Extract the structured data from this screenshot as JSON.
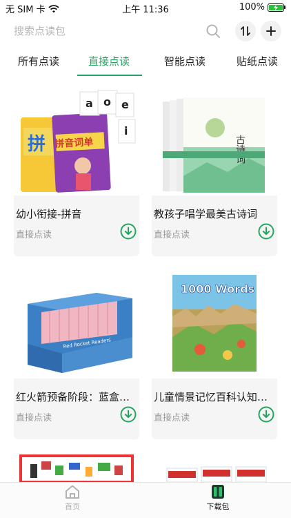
{
  "status": {
    "carrier": "无 SIM 卡",
    "time": "上午 11:36",
    "battery": "100%"
  },
  "search": {
    "placeholder": "搜索点读包"
  },
  "tabs": [
    {
      "label": "所有点读",
      "active": false
    },
    {
      "label": "直接点读",
      "active": true
    },
    {
      "label": "智能点读",
      "active": false
    },
    {
      "label": "贴纸点读",
      "active": false
    }
  ],
  "books": [
    {
      "title": "幼小衔接-拼音",
      "subtitle": "直接点读",
      "cover_text": "拼音词单"
    },
    {
      "title": "教孩子唱学最美古诗词",
      "subtitle": "直接点读",
      "cover_text": "古诗词"
    },
    {
      "title": "红火箭预备阶段：蓝盒…",
      "subtitle": "直接点读",
      "cover_text": "Red Rocket Readers"
    },
    {
      "title": "儿童情景记忆百科认知…",
      "subtitle": "直接点读",
      "cover_text": "1000 Words"
    }
  ],
  "bottom_nav": [
    {
      "label": "首页",
      "active": false
    },
    {
      "label": "下载包",
      "active": true
    }
  ],
  "colors": {
    "accent": "#24a55f"
  }
}
